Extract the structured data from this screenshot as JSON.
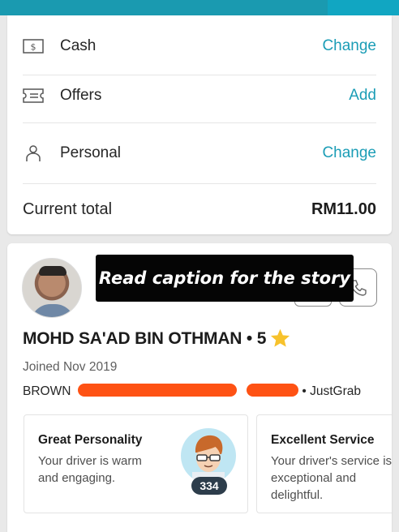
{
  "payment": {
    "rows": [
      {
        "icon": "cash-icon",
        "label": "Cash",
        "action": "Change"
      },
      {
        "icon": "offers-ticket-icon",
        "label": "Offers",
        "action": "Add"
      },
      {
        "icon": "person-icon",
        "label": "Personal",
        "action": "Change"
      }
    ],
    "total_label": "Current total",
    "total_value": "RM11.00"
  },
  "caption": "Read caption for the story",
  "driver": {
    "name": "MOHD SA'AD BIN OTHMAN • 5",
    "joined": "Joined Nov 2019",
    "vehicle_prefix": "BROWN",
    "vehicle_suffix": "• JustGrab"
  },
  "compliments": [
    {
      "title": "Great Personality",
      "description": "Your driver is warm and engaging.",
      "count": "334",
      "icon": "cool-face-badge-icon"
    },
    {
      "title": "Excellent Service",
      "description": "Your driver's service is exceptional and delightful."
    }
  ],
  "colors": {
    "accent": "#1b9db6",
    "topbar": "#1a9ab0",
    "redaction": "#fe5214",
    "star": "#f7c22c"
  }
}
